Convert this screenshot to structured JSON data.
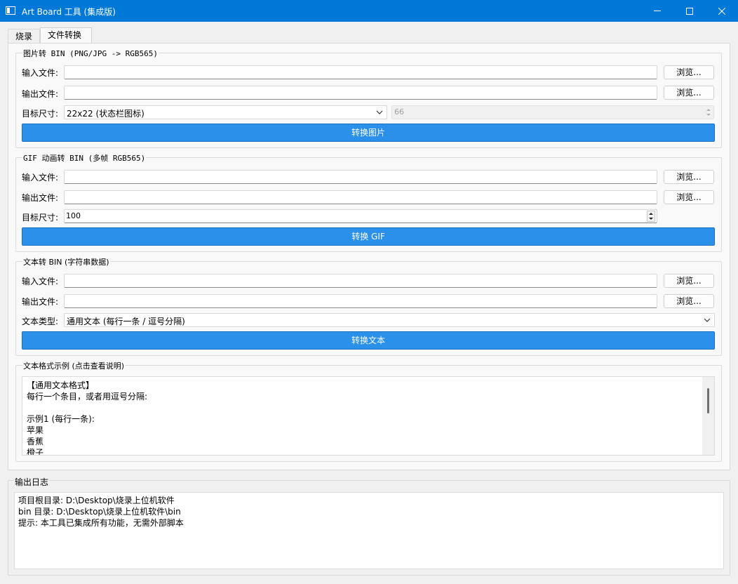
{
  "window": {
    "title": "Art Board 工具 (集成版)"
  },
  "tabs": [
    {
      "label": "烧录"
    },
    {
      "label": "文件转换"
    }
  ],
  "image_section": {
    "title": "图片转 BIN (PNG/JPG -> RGB565)",
    "input_label": "输入文件:",
    "input_value": "",
    "output_label": "输出文件:",
    "output_value": "",
    "browse_label": "浏览...",
    "size_label": "目标尺寸:",
    "size_selected": "22x22 (状态栏图标)",
    "size_custom_value": "66",
    "convert_label": "转换图片"
  },
  "gif_section": {
    "title": "GIF 动画转 BIN (多帧 RGB565)",
    "input_label": "输入文件:",
    "input_value": "",
    "output_label": "输出文件:",
    "output_value": "",
    "browse_label": "浏览...",
    "size_label": "目标尺寸:",
    "size_value": "100",
    "convert_label": "转换 GIF"
  },
  "text_section": {
    "title": "文本转 BIN (字符串数据)",
    "input_label": "输入文件:",
    "input_value": "",
    "output_label": "输出文件:",
    "output_value": "",
    "browse_label": "浏览...",
    "type_label": "文本类型:",
    "type_selected": "通用文本 (每行一条 / 逗号分隔)",
    "convert_label": "转换文本"
  },
  "example_section": {
    "title": "文本格式示例 (点击查看说明)",
    "lines": [
      "【通用文本格式】",
      "每行一个条目，或者用逗号分隔:",
      "",
      "示例1 (每行一条):",
      "苹果",
      "香蕉",
      "橙子"
    ]
  },
  "log_section": {
    "title": "输出日志",
    "lines": [
      "项目根目录: D:\\Desktop\\烧录上位机软件",
      "bin 目录: D:\\Desktop\\烧录上位机软件\\bin",
      "提示: 本工具已集成所有功能，无需外部脚本"
    ]
  },
  "colors": {
    "titlebar": "#0078d7",
    "primary_button": "#2a90e9"
  }
}
